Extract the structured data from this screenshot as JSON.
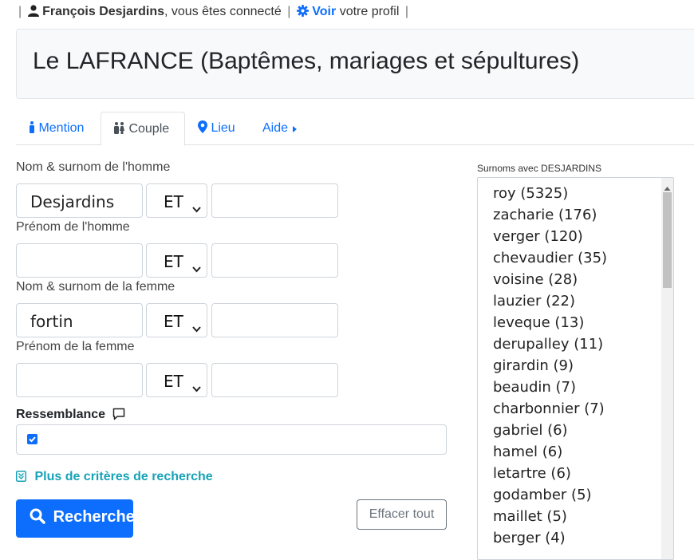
{
  "topbar": {
    "separator": "|",
    "user_name": "François Desjardins",
    "connected_text": ", vous êtes connecté",
    "voir_label": "Voir",
    "profil_text": "votre profil"
  },
  "header": {
    "title": "Le LAFRANCE (Baptêmes, mariages et sépultures)"
  },
  "tabs": [
    {
      "label": "Mention",
      "icon": "person-icon"
    },
    {
      "label": "Couple",
      "icon": "couple-icon"
    },
    {
      "label": "Lieu",
      "icon": "map-pin-icon"
    },
    {
      "label": "Aide",
      "icon": "caret-right-icon"
    }
  ],
  "form": {
    "homme_nom_label": "Nom & surnom de l'homme",
    "homme_nom_value": "Desjardins",
    "homme_prenom_label": "Prénom de l'homme",
    "femme_nom_label": "Nom & surnom de la femme",
    "femme_nom_value": "fortin",
    "femme_prenom_label": "Prénom de la femme",
    "operator": "ET",
    "ressemblance_label": "Ressemblance",
    "ressemblance_checked": true,
    "more_criteria": "Plus de critères de recherche",
    "search_button": "Rechercher",
    "clear_button": "Effacer tout"
  },
  "surnoms": {
    "title": "Surnoms avec DESJARDINS",
    "items": [
      "roy (5325)",
      "zacharie (176)",
      "verger (120)",
      "chevaudier (35)",
      "voisine (28)",
      "lauzier (22)",
      "leveque (13)",
      "derupalley (11)",
      "girardin (9)",
      "beaudin (7)",
      "charbonnier (7)",
      "gabriel (6)",
      "hamel (6)",
      "letartre (6)",
      "godamber (5)",
      "maillet (5)",
      "berger (4)"
    ]
  },
  "colors": {
    "primary": "#0d6efd",
    "info": "#17a2b8",
    "header_bg": "#f8f9fa"
  }
}
